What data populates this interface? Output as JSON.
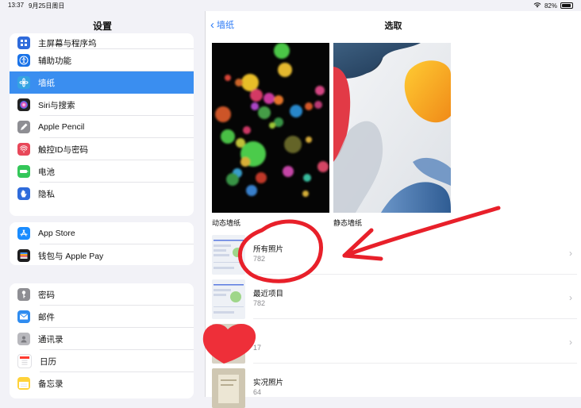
{
  "status": {
    "time": "13:37",
    "date": "9月25日周日",
    "battery": "82%",
    "battery_level": 0.82
  },
  "sidebar": {
    "title": "设置",
    "group1": [
      {
        "label": "主屏幕与程序坞",
        "icon": "home-screen-icon",
        "color": "#2f6bdb"
      },
      {
        "label": "辅助功能",
        "icon": "accessibility-icon",
        "color": "#1a73e8"
      },
      {
        "label": "墙纸",
        "icon": "wallpaper-icon",
        "color": "#34a3e3",
        "selected": true
      },
      {
        "label": "Siri与搜索",
        "icon": "siri-icon",
        "color": "#222"
      },
      {
        "label": "Apple Pencil",
        "icon": "pencil-icon",
        "color": "#8e8e93"
      },
      {
        "label": "触控ID与密码",
        "icon": "fingerprint-icon",
        "color": "#e8485a"
      },
      {
        "label": "电池",
        "icon": "battery-icon",
        "color": "#34c759"
      },
      {
        "label": "隐私",
        "icon": "hand-icon",
        "color": "#2f6bdb"
      }
    ],
    "group2": [
      {
        "label": "App Store",
        "icon": "app-store-icon",
        "color": "#1a8cff"
      },
      {
        "label": "钱包与 Apple Pay",
        "icon": "wallet-icon",
        "color": "#1c1c1e"
      }
    ],
    "group3": [
      {
        "label": "密码",
        "icon": "key-icon",
        "color": "#8e8e93"
      },
      {
        "label": "邮件",
        "icon": "mail-icon",
        "color": "#2f8cf0"
      },
      {
        "label": "通讯录",
        "icon": "contacts-icon",
        "color": "#b8b8bd"
      },
      {
        "label": "日历",
        "icon": "calendar-icon",
        "color": "#ffffff"
      },
      {
        "label": "备忘录",
        "icon": "notes-icon",
        "color": "#ffd23a"
      }
    ]
  },
  "main": {
    "back_label": "墙纸",
    "title": "选取",
    "dynamic_label": "动态墙纸",
    "static_label": "静态墙纸",
    "albums": [
      {
        "name": "所有照片",
        "count": "782"
      },
      {
        "name": "最近项目",
        "count": "782"
      },
      {
        "name": "",
        "count": "17"
      },
      {
        "name": "实况照片",
        "count": "64"
      }
    ]
  },
  "colors": {
    "accent": "#2f7cf6",
    "selected": "#3a8ef0",
    "annotation": "#e8202a"
  }
}
